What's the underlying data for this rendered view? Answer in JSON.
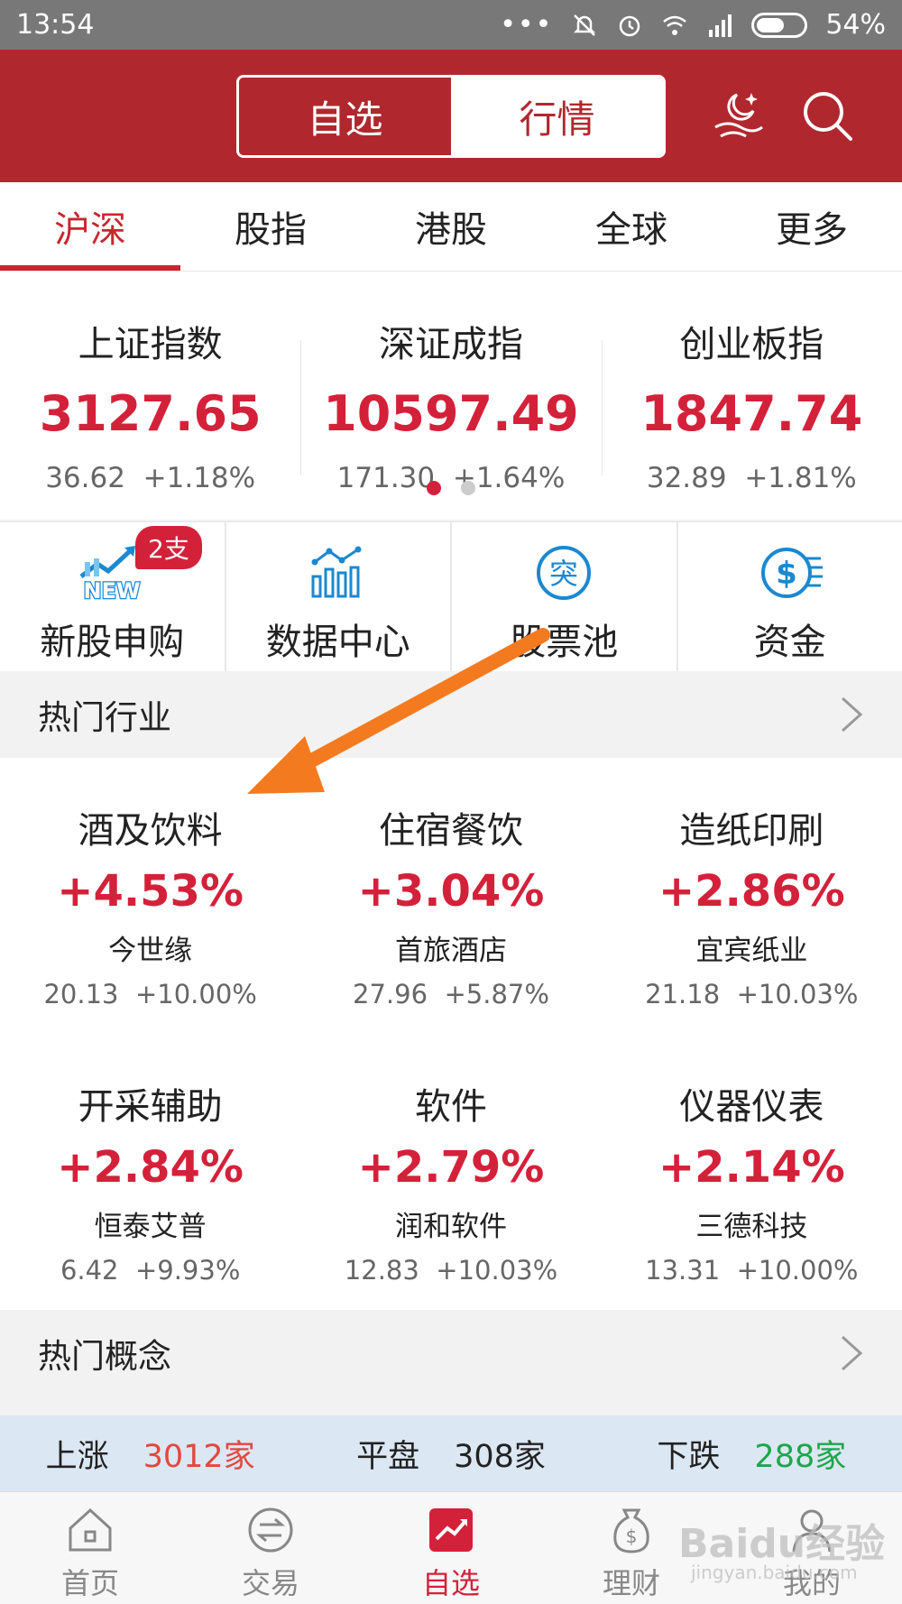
{
  "status_bar": {
    "time": "13:54",
    "battery": "54%"
  },
  "header": {
    "segment_left": "自选",
    "segment_right": "行情"
  },
  "tabs": [
    {
      "label": "沪深",
      "active": true
    },
    {
      "label": "股指"
    },
    {
      "label": "港股"
    },
    {
      "label": "全球"
    },
    {
      "label": "更多"
    }
  ],
  "indices": [
    {
      "name": "上证指数",
      "value": "3127.65",
      "change": "36.62",
      "pct": "+1.18%"
    },
    {
      "name": "深证成指",
      "value": "10597.49",
      "change": "171.30",
      "pct": "+1.64%"
    },
    {
      "name": "创业板指",
      "value": "1847.74",
      "change": "32.89",
      "pct": "+1.81%"
    }
  ],
  "features": [
    {
      "label": "新股申购",
      "badge": "2支",
      "icon": "new-stock-icon"
    },
    {
      "label": "数据中心",
      "icon": "data-chart-icon"
    },
    {
      "label": "股票池",
      "icon": "breakout-icon",
      "icon_text": "突"
    },
    {
      "label": "资金",
      "icon": "capital-icon",
      "icon_text": "$"
    }
  ],
  "hot_industries": {
    "title": "热门行业",
    "items": [
      {
        "name": "酒及饮料",
        "pct": "+4.53%",
        "stock": "今世缘",
        "price": "20.13",
        "stock_pct": "+10.00%"
      },
      {
        "name": "住宿餐饮",
        "pct": "+3.04%",
        "stock": "首旅酒店",
        "price": "27.96",
        "stock_pct": "+5.87%"
      },
      {
        "name": "造纸印刷",
        "pct": "+2.86%",
        "stock": "宜宾纸业",
        "price": "21.18",
        "stock_pct": "+10.03%"
      },
      {
        "name": "开采辅助",
        "pct": "+2.84%",
        "stock": "恒泰艾普",
        "price": "6.42",
        "stock_pct": "+9.93%"
      },
      {
        "name": "软件",
        "pct": "+2.79%",
        "stock": "润和软件",
        "price": "12.83",
        "stock_pct": "+10.03%"
      },
      {
        "name": "仪器仪表",
        "pct": "+2.14%",
        "stock": "三德科技",
        "price": "13.31",
        "stock_pct": "+10.00%"
      }
    ]
  },
  "hot_concepts": {
    "title": "热门概念"
  },
  "market_summary": {
    "up_label": "上涨",
    "up_value": "3012家",
    "flat_label": "平盘",
    "flat_value": "308家",
    "down_label": "下跌",
    "down_value": "288家"
  },
  "bottom_nav": [
    {
      "label": "首页",
      "icon": "home-icon"
    },
    {
      "label": "交易",
      "icon": "exchange-icon"
    },
    {
      "label": "自选",
      "icon": "watchlist-icon",
      "active": true
    },
    {
      "label": "理财",
      "icon": "money-bag-icon"
    },
    {
      "label": "我的",
      "icon": "user-icon"
    }
  ],
  "watermark": {
    "text": "Baidu经验",
    "sub": "jingyan.baidu.com"
  },
  "colors": {
    "brand_red": "#b0282e",
    "up_red": "#d4213a",
    "down_green": "#1fa64a",
    "accent_orange": "#f47a20"
  }
}
